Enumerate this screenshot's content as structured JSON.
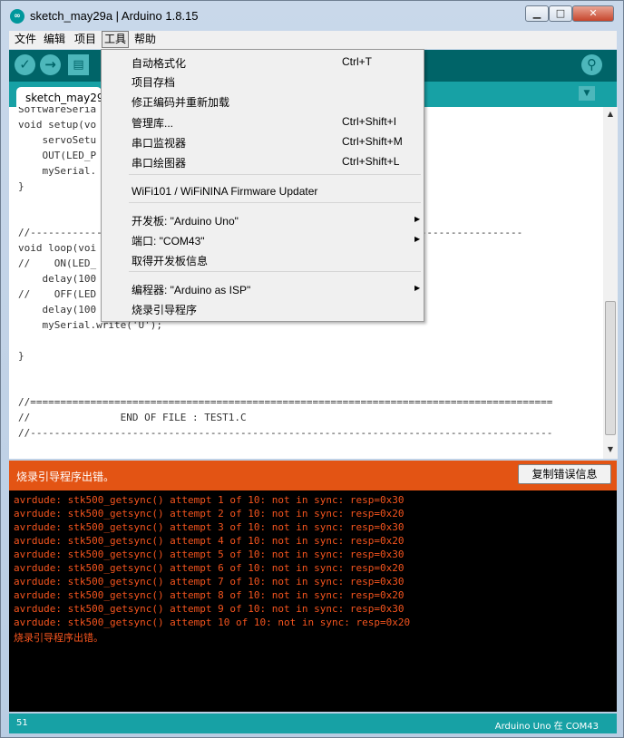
{
  "window": {
    "title": "sketch_may29a | Arduino 1.8.15",
    "app_icon": "arduino-icon"
  },
  "window_controls": {
    "minimize": "▁",
    "maximize": "□",
    "close": "✕"
  },
  "menubar": {
    "items": [
      "文件",
      "编辑",
      "项目",
      "工具",
      "帮助"
    ],
    "active": "工具"
  },
  "toolbar": {
    "verify_icon": "✓",
    "upload_icon": "→",
    "new_icon": "▤",
    "serial_monitor_icon": "⚲"
  },
  "tab": {
    "label": "sketch_may29",
    "menu_icon": "▼"
  },
  "code": {
    "lines": [
      "SoftwareSeria",
      "void setup(vo",
      "    servoSetu",
      "    OUT(LED_P",
      "    mySerial.",
      "}",
      "",
      "",
      "//------------                                                 ---------------------",
      "void loop(voi",
      "//    ON(LED_",
      "    delay(100",
      "//    OFF(LED",
      "    delay(100",
      "    mySerial.write('U');",
      "",
      "}",
      "",
      "",
      "//=======================================================================================",
      "//               END OF FILE : TEST1.C",
      "//---------------------------------------------------------------------------------------"
    ]
  },
  "tools_menu": {
    "items": [
      {
        "label": "自动格式化",
        "shortcut": "Ctrl+T"
      },
      {
        "label": "项目存档",
        "shortcut": ""
      },
      {
        "label": "修正编码并重新加载",
        "shortcut": ""
      },
      {
        "label": "管理库...",
        "shortcut": "Ctrl+Shift+I"
      },
      {
        "label": "串口监视器",
        "shortcut": "Ctrl+Shift+M"
      },
      {
        "label": "串口绘图器",
        "shortcut": "Ctrl+Shift+L"
      },
      {
        "label": "WiFi101 / WiFiNINA Firmware Updater",
        "shortcut": ""
      },
      {
        "label": "开发板: \"Arduino Uno\"",
        "shortcut": "",
        "submenu": "▶"
      },
      {
        "label": "端口: \"COM43\"",
        "shortcut": "",
        "submenu": "▶"
      },
      {
        "label": "取得开发板信息",
        "shortcut": ""
      },
      {
        "label": "编程器: \"Arduino as ISP\"",
        "shortcut": "",
        "submenu": "▶"
      },
      {
        "label": "烧录引导程序",
        "shortcut": ""
      }
    ]
  },
  "status": {
    "message": "烧录引导程序出错。",
    "copy_button": "复制错误信息"
  },
  "console": {
    "lines": [
      "avrdude: stk500_getsync() attempt 1 of 10: not in sync: resp=0x30",
      "avrdude: stk500_getsync() attempt 2 of 10: not in sync: resp=0x20",
      "avrdude: stk500_getsync() attempt 3 of 10: not in sync: resp=0x30",
      "avrdude: stk500_getsync() attempt 4 of 10: not in sync: resp=0x20",
      "avrdude: stk500_getsync() attempt 5 of 10: not in sync: resp=0x30",
      "avrdude: stk500_getsync() attempt 6 of 10: not in sync: resp=0x20",
      "avrdude: stk500_getsync() attempt 7 of 10: not in sync: resp=0x30",
      "avrdude: stk500_getsync() attempt 8 of 10: not in sync: resp=0x20",
      "avrdude: stk500_getsync() attempt 9 of 10: not in sync: resp=0x30",
      "avrdude: stk500_getsync() attempt 10 of 10: not in sync: resp=0x20",
      "烧录引导程序出错。"
    ]
  },
  "footer": {
    "line_number": "51",
    "board": "Arduino Uno 在 COM43"
  },
  "colors": {
    "toolbar": "#006468",
    "tabbar": "#17a1a5",
    "status_error": "#e35414",
    "console_text": "#f4541e",
    "console_bg": "#000000"
  }
}
